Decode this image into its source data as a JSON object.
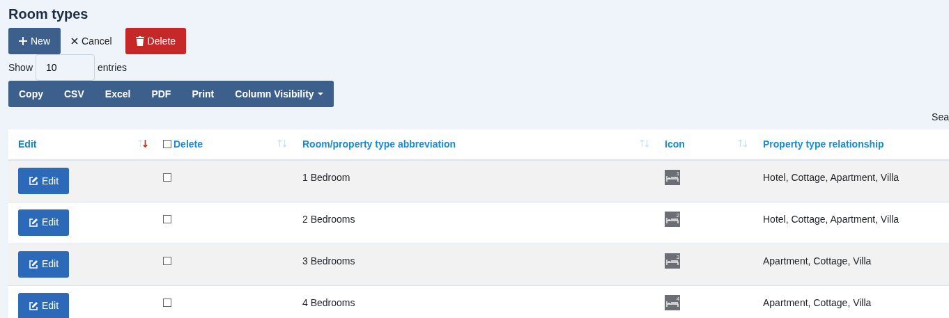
{
  "title": "Room types",
  "actions": [
    {
      "kind": "new",
      "label": "New"
    },
    {
      "kind": "cancel",
      "label": "Cancel"
    },
    {
      "kind": "delete",
      "label": "Delete"
    }
  ],
  "length": {
    "before": "Show",
    "value": "10",
    "after": "entries"
  },
  "export_buttons": [
    {
      "label": "Copy",
      "dropdown": false
    },
    {
      "label": "CSV",
      "dropdown": false
    },
    {
      "label": "Excel",
      "dropdown": false
    },
    {
      "label": "PDF",
      "dropdown": false
    },
    {
      "label": "Print",
      "dropdown": false
    },
    {
      "label": "Column Visibility",
      "dropdown": true
    }
  ],
  "search": {
    "label": "Sea"
  },
  "table": {
    "columns": [
      {
        "label": "Edit",
        "sortable": true,
        "sorted_desc": true
      },
      {
        "label": "Delete",
        "sortable": true,
        "sorted_desc": false,
        "checkbox": {
          "checked": false
        }
      },
      {
        "label": "Room/property type abbreviation",
        "sortable": true,
        "sorted_desc": false
      },
      {
        "label": "Icon",
        "sortable": true,
        "sorted_desc": false
      },
      {
        "label": "Property type relationship",
        "sortable": false
      }
    ],
    "rows": [
      {
        "edit": "Edit",
        "checked": false,
        "name": "1 Bedroom",
        "icon_number": "1",
        "relationship": "Hotel, Cottage, Apartment, Villa"
      },
      {
        "edit": "Edit",
        "checked": false,
        "name": "2 Bedrooms",
        "icon_number": "2",
        "relationship": "Hotel, Cottage, Apartment, Villa"
      },
      {
        "edit": "Edit",
        "checked": false,
        "name": "3 Bedrooms",
        "icon_number": "3",
        "relationship": "Apartment, Cottage, Villa"
      },
      {
        "edit": "Edit",
        "checked": false,
        "name": "4 Bedrooms",
        "icon_number": "4",
        "relationship": "Apartment, Cottage, Villa"
      }
    ]
  }
}
